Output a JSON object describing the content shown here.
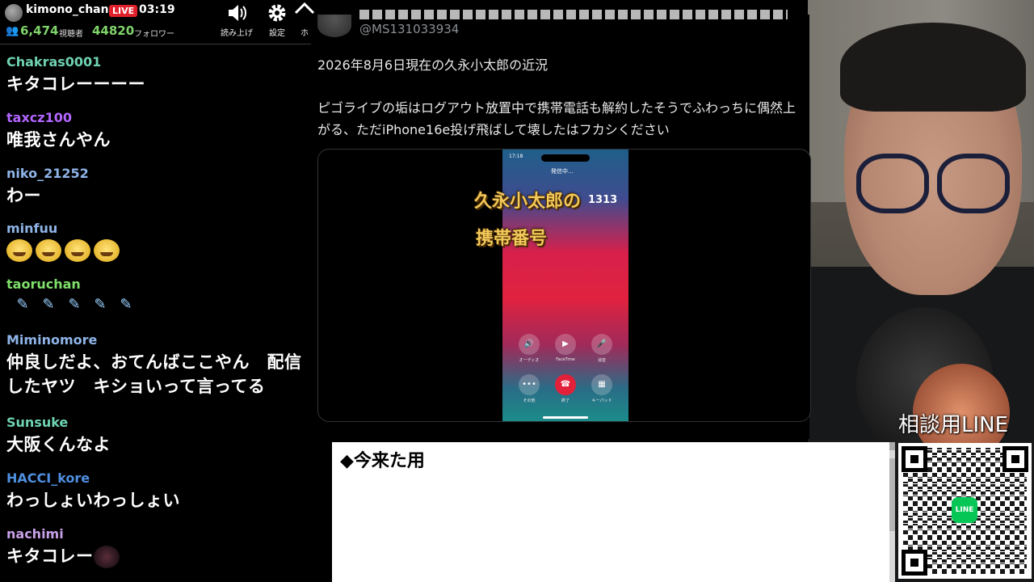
{
  "stream": {
    "username": "kimono_chan",
    "live_badge": "LIVE",
    "time": "03:19",
    "viewers": "6,474",
    "viewers_label": "視聴者",
    "followers": "44820",
    "followers_label": "フォロワー"
  },
  "toolbar": {
    "read_label": "読み上げ",
    "settings_label": "設定",
    "more_label": "ホ"
  },
  "chat": [
    {
      "name": "Chakras0001",
      "color": "#6fd3b0",
      "text": "キタコレーーーー"
    },
    {
      "name": "taxcz100",
      "color": "#b266ff",
      "text": "唯我さんやん"
    },
    {
      "name": "niko_21252",
      "color": "#8fb4e8",
      "text": "わー"
    },
    {
      "name": "minfuu",
      "color": "#8fb4e8",
      "text": ""
    },
    {
      "name": "taoruchan",
      "color": "#7fe06a",
      "text": ""
    },
    {
      "name": "Miminomore",
      "color": "#8fb4e8",
      "text": "仲良しだよ、おてんばここやん　配信したヤツ　キショいって言ってる"
    },
    {
      "name": "Sunsuke",
      "color": "#6fd3b0",
      "text": "大阪くんなよ"
    },
    {
      "name": "HACCI_kore",
      "color": "#4f8fe0",
      "text": "わっしょいわっしょい"
    },
    {
      "name": "nachimi",
      "color": "#c8a0e8",
      "text": "キタコレー"
    }
  ],
  "tweet": {
    "handle": "@MS131033934",
    "line1": "2026年8月6日現在の久永小太郎の近況",
    "line2": "ピゴライブの垢はログアウト放置中で携帯電話も解約したそうでふわっちに偶然上がる、ただiPhone16e投げ飛ばして壊したはフカシください",
    "media": {
      "caption1": "久永小太郎の",
      "caption2": "携帯番号",
      "number": "1313",
      "calling": "発信中...",
      "status_time": "17:18",
      "buttons": [
        "オーディオ",
        "FaceTime",
        "消音",
        "その他",
        "終了",
        "キーパッド"
      ]
    }
  },
  "notes": {
    "title": "◆今来た用"
  },
  "line": {
    "label": "相談用LINE",
    "logo_text": "LINE"
  }
}
